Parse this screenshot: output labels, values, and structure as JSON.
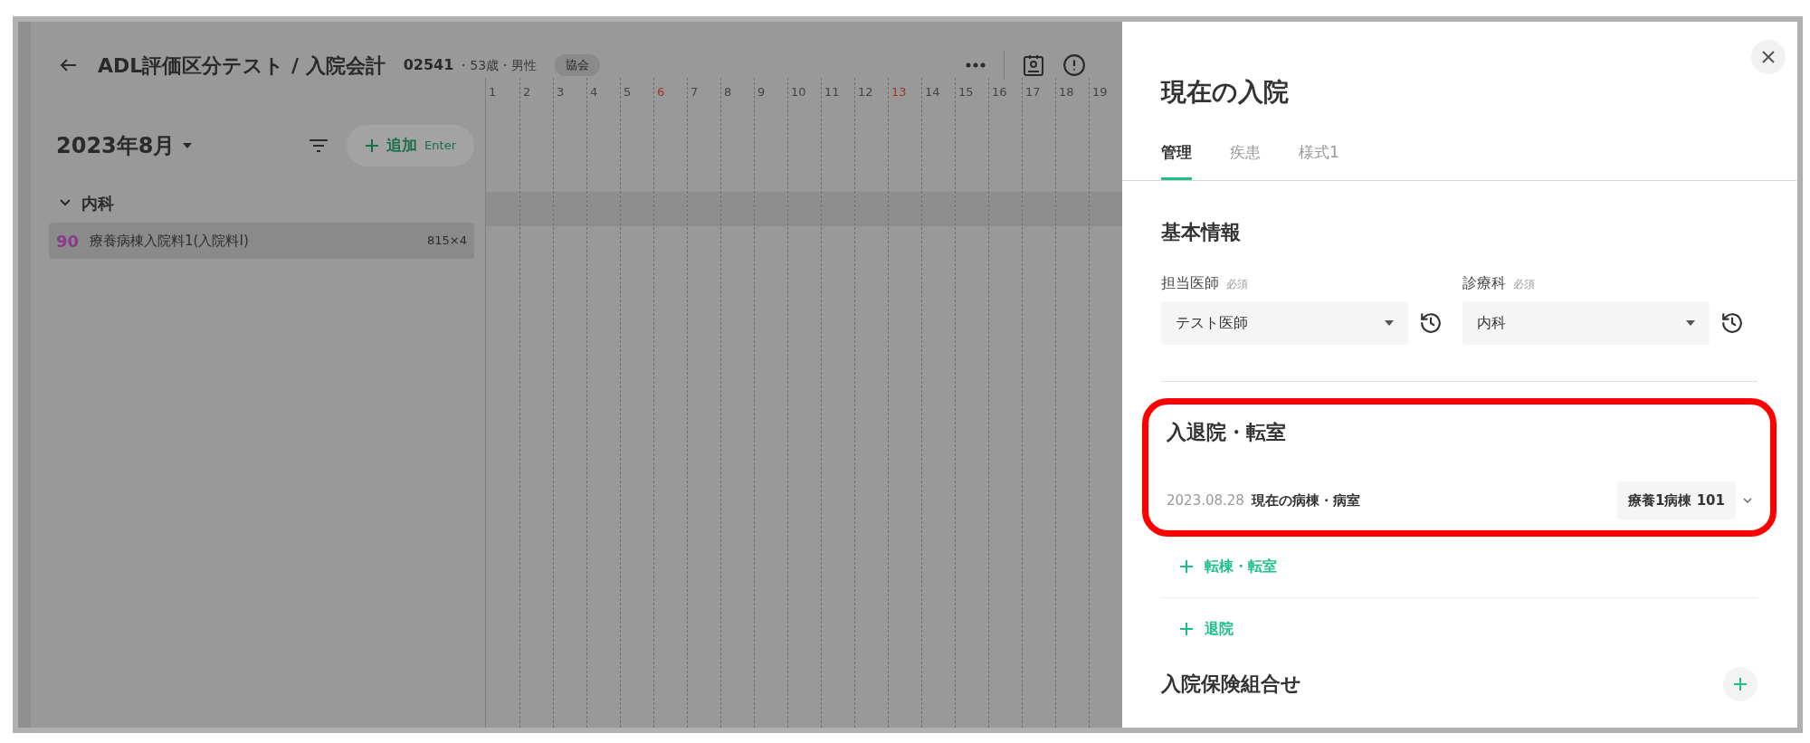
{
  "header": {
    "title": "ADL評価区分テスト / 入院会計",
    "patient_id": "02541",
    "patient_info": "・53歳・男性",
    "badge": "協会"
  },
  "toolbar": {
    "month": "2023年8月",
    "add_button": {
      "label": "追加",
      "shortcut": "Enter"
    }
  },
  "days": [
    {
      "label": "1",
      "holiday": false
    },
    {
      "label": "2",
      "holiday": false
    },
    {
      "label": "3",
      "holiday": false
    },
    {
      "label": "4",
      "holiday": false
    },
    {
      "label": "5",
      "holiday": false
    },
    {
      "label": "6",
      "holiday": true
    },
    {
      "label": "7",
      "holiday": false
    },
    {
      "label": "8",
      "holiday": false
    },
    {
      "label": "9",
      "holiday": false
    },
    {
      "label": "10",
      "holiday": false
    },
    {
      "label": "11",
      "holiday": false
    },
    {
      "label": "12",
      "holiday": false
    },
    {
      "label": "13",
      "holiday": true
    },
    {
      "label": "14",
      "holiday": false
    },
    {
      "label": "15",
      "holiday": false
    },
    {
      "label": "16",
      "holiday": false
    },
    {
      "label": "17",
      "holiday": false
    },
    {
      "label": "18",
      "holiday": false
    },
    {
      "label": "19",
      "holiday": false
    }
  ],
  "groups": [
    {
      "name": "内科",
      "expanded": true,
      "items": [
        {
          "code": "90",
          "name": "療養病棟入院料1(入院料I)",
          "quantity": "815×4"
        }
      ]
    }
  ],
  "panel": {
    "title": "現在の入院",
    "tabs": [
      {
        "label": "管理",
        "selected": true
      },
      {
        "label": "疾患",
        "selected": false
      },
      {
        "label": "様式1",
        "selected": false
      }
    ],
    "basic_info": {
      "title": "基本情報",
      "fields": [
        {
          "label": "担当医師",
          "required": "必須",
          "value": "テスト医師"
        },
        {
          "label": "診療科",
          "required": "必須",
          "value": "内科"
        }
      ]
    },
    "admission": {
      "title": "入退院・転室",
      "highlighted": true,
      "entries": [
        {
          "date": "2023.08.28",
          "label": "現在の病棟・病室",
          "ward": "療養1病棟 101"
        }
      ],
      "actions": [
        "転棟・転室",
        "退院"
      ]
    },
    "insurance": {
      "title": "入院保険組合せ"
    }
  }
}
